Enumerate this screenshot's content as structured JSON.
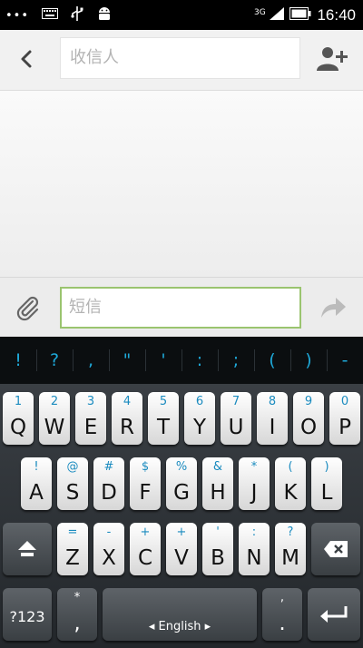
{
  "status_bar": {
    "left_icons": [
      "more-icon",
      "keyboard-icon",
      "usb-icon",
      "android-icon"
    ],
    "network": "3G",
    "time": "16:40"
  },
  "header": {
    "recipient_placeholder": "收信人"
  },
  "compose": {
    "message_placeholder": "短信"
  },
  "symbols": [
    "!",
    "?",
    ",",
    "\"",
    "'",
    ":",
    ";",
    "(",
    ")",
    "-"
  ],
  "keyboard": {
    "row1": [
      {
        "main": "Q",
        "sub": "1"
      },
      {
        "main": "W",
        "sub": "2"
      },
      {
        "main": "E",
        "sub": "3"
      },
      {
        "main": "R",
        "sub": "4"
      },
      {
        "main": "T",
        "sub": "5"
      },
      {
        "main": "Y",
        "sub": "6"
      },
      {
        "main": "U",
        "sub": "7"
      },
      {
        "main": "I",
        "sub": "8"
      },
      {
        "main": "O",
        "sub": "9"
      },
      {
        "main": "P",
        "sub": "0"
      }
    ],
    "row2": [
      {
        "main": "A",
        "sub": "!"
      },
      {
        "main": "S",
        "sub": "@"
      },
      {
        "main": "D",
        "sub": "#"
      },
      {
        "main": "F",
        "sub": "$"
      },
      {
        "main": "G",
        "sub": "%"
      },
      {
        "main": "H",
        "sub": "&"
      },
      {
        "main": "J",
        "sub": "*"
      },
      {
        "main": "K",
        "sub": "("
      },
      {
        "main": "L",
        "sub": ")"
      }
    ],
    "row3": [
      {
        "main": "Z",
        "sub": "="
      },
      {
        "main": "X",
        "sub": "-"
      },
      {
        "main": "C",
        "sub": "+"
      },
      {
        "main": "V",
        "sub": "+"
      },
      {
        "main": "B",
        "sub": "'"
      },
      {
        "main": "N",
        "sub": ":"
      },
      {
        "main": "M",
        "sub": "?"
      }
    ],
    "symbols_key": "?123",
    "comma_key": {
      "main": ",",
      "sub": "*"
    },
    "space_label": "English",
    "period_key": {
      "main": ".",
      "sub": ","
    }
  },
  "colors": {
    "accent": "#1ea8d8",
    "input_focus_border": "#9ac46f"
  }
}
